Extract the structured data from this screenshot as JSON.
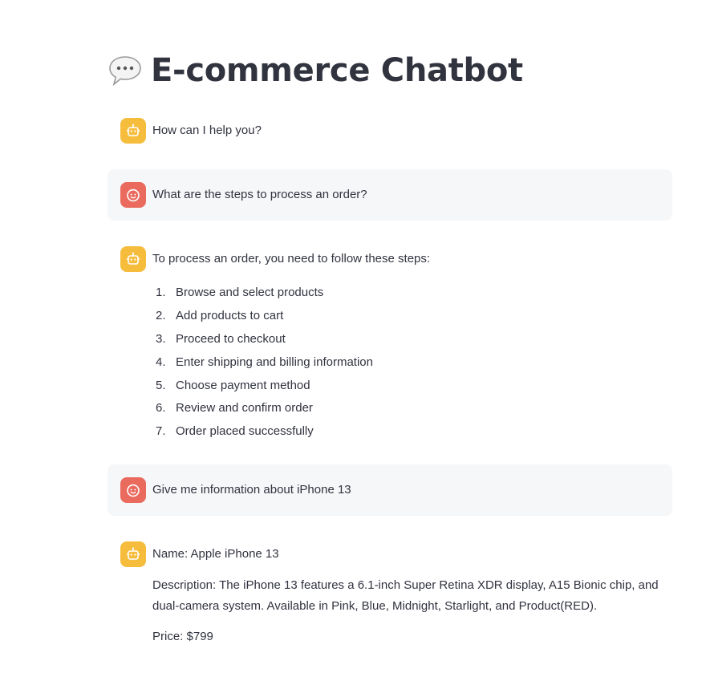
{
  "page": {
    "title": "E-commerce Chatbot",
    "title_icon": "speech-balloon-icon"
  },
  "colors": {
    "bot_avatar": "#f6bd3d",
    "user_avatar": "#ea6a5e",
    "user_bubble": "#f6f7f9",
    "text": "#31333f"
  },
  "messages": [
    {
      "role": "assistant",
      "avatar_icon": "robot-icon",
      "text": "How can I help you?"
    },
    {
      "role": "user",
      "avatar_icon": "smiley-face-icon",
      "text": "What are the steps to process an order?"
    },
    {
      "role": "assistant",
      "avatar_icon": "robot-icon",
      "text": "To process an order, you need to follow these steps:",
      "steps": [
        {
          "num": "1.",
          "text": "Browse and select products"
        },
        {
          "num": "2.",
          "text": "Add products to cart"
        },
        {
          "num": "3.",
          "text": "Proceed to checkout"
        },
        {
          "num": "4.",
          "text": "Enter shipping and billing information"
        },
        {
          "num": "5.",
          "text": "Choose payment method"
        },
        {
          "num": "6.",
          "text": "Review and confirm order"
        },
        {
          "num": "7.",
          "text": "Order placed successfully"
        }
      ]
    },
    {
      "role": "user",
      "avatar_icon": "smiley-face-icon",
      "text": "Give me information about iPhone 13"
    },
    {
      "role": "assistant",
      "avatar_icon": "robot-icon",
      "name_line": "Name: Apple iPhone 13",
      "description_line": "Description: The iPhone 13 features a 6.1-inch Super Retina XDR display, A15 Bionic chip, and dual-camera system. Available in Pink, Blue, Midnight, Starlight, and Product(RED).",
      "price_line": "Price: $799"
    }
  ]
}
